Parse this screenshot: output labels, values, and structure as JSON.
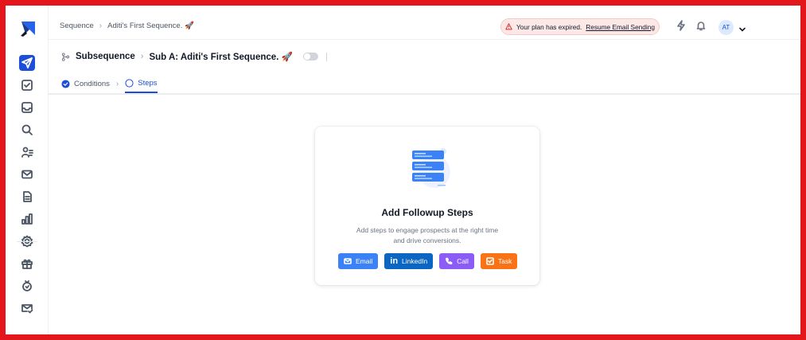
{
  "breadcrumb": {
    "root": "Sequence",
    "current": "Aditi's First Sequence. 🚀"
  },
  "plan_banner": {
    "message": "Your plan has expired.",
    "link": "Resume Email Sending"
  },
  "user": {
    "initials": "AT"
  },
  "subheader": {
    "title": "Subsequence",
    "subsequence_name": "Sub A: Aditi's First Sequence. 🚀"
  },
  "tabs": [
    {
      "label": "Conditions",
      "state": "completed"
    },
    {
      "label": "Steps",
      "state": "active"
    }
  ],
  "empty_state": {
    "title": "Add Followup Steps",
    "description_line1": "Add steps to engage prospects at the right time",
    "description_line2": "and drive conversions."
  },
  "buttons": {
    "email": {
      "label": "Email",
      "color": "#3b82f6",
      "icon": "mail-icon"
    },
    "linkedin": {
      "label": "LinkedIn",
      "color": "#0a66c2",
      "icon": "linkedin-icon"
    },
    "call": {
      "label": "Call",
      "color": "#8b5cf6",
      "icon": "phone-icon"
    },
    "task": {
      "label": "Task",
      "color": "#f97316",
      "icon": "task-icon"
    }
  },
  "sidebar_icons": [
    "sequence-icon",
    "tasks-icon",
    "inbox-icon",
    "search-icon",
    "contacts-icon",
    "mail-icon",
    "templates-icon",
    "analytics-icon",
    "settings-icon",
    "gift-icon",
    "rewards-icon",
    "email-check-icon"
  ],
  "colors": {
    "primary": "#1d4ed8",
    "banner_bg": "#fde8e8",
    "warning": "#dc2626"
  }
}
